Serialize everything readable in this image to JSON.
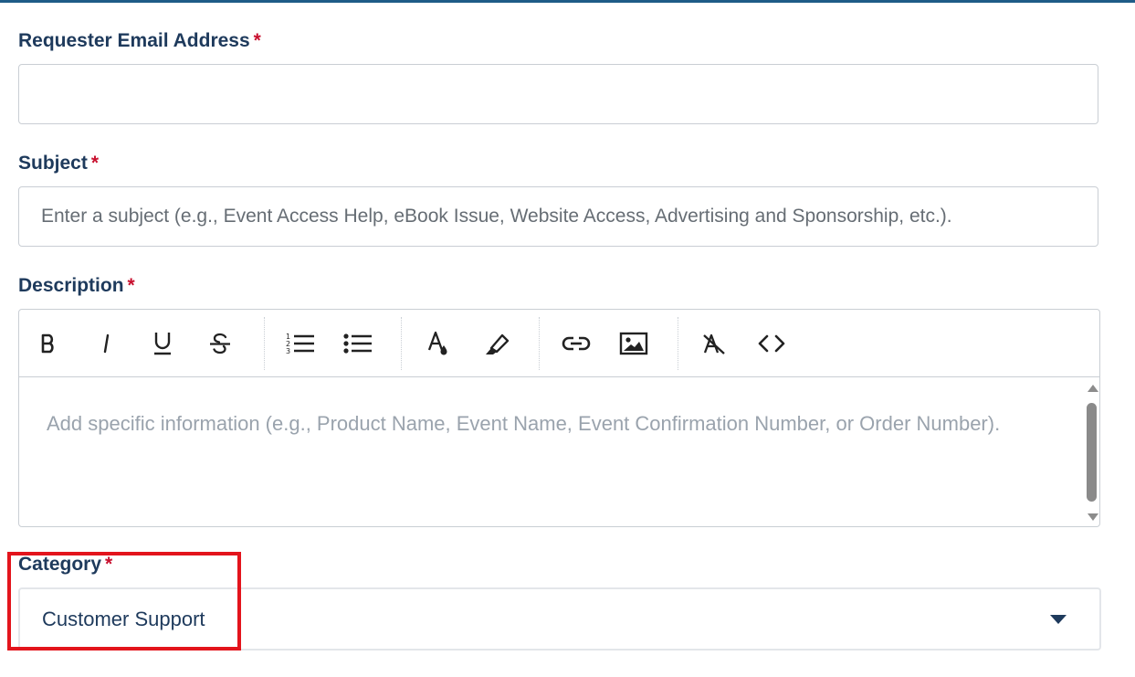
{
  "form": {
    "email": {
      "label": "Requester Email Address",
      "required_mark": "*",
      "value": "",
      "placeholder": ""
    },
    "subject": {
      "label": "Subject",
      "required_mark": "*",
      "value": "",
      "placeholder": "Enter a subject (e.g., Event Access Help, eBook Issue, Website Access, Advertising and Sponsorship, etc.)."
    },
    "description": {
      "label": "Description",
      "required_mark": "*",
      "placeholder": "Add specific information (e.g., Product Name, Event Name, Event Confirmation Number, or Order Number).",
      "toolbar": {
        "bold": "bold-icon",
        "italic": "italic-icon",
        "underline": "underline-icon",
        "strikethrough": "strikethrough-icon",
        "ordered_list": "ordered-list-icon",
        "unordered_list": "unordered-list-icon",
        "text_color": "text-color-icon",
        "highlight": "highlighter-icon",
        "link": "link-icon",
        "image": "image-icon",
        "clear_format": "clear-format-icon",
        "code": "code-icon"
      }
    },
    "category": {
      "label": "Category",
      "required_mark": "*",
      "selected": "Customer Support"
    }
  },
  "colors": {
    "label": "#1e3a5c",
    "required": "#c8102e",
    "top_bar": "#1f5c87",
    "highlight_box": "#e3141c"
  }
}
